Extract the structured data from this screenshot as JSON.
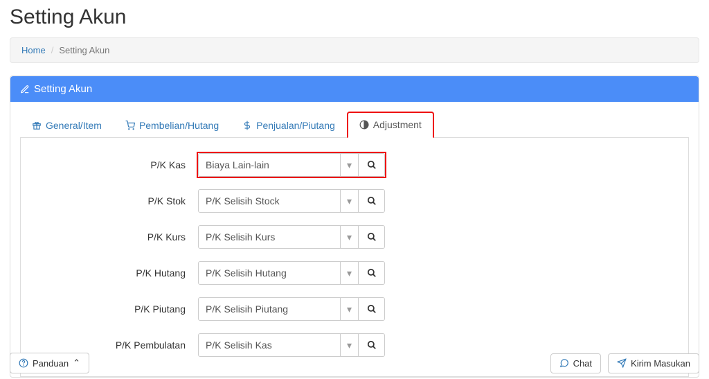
{
  "page": {
    "title": "Setting Akun"
  },
  "breadcrumb": {
    "home": "Home",
    "current": "Setting Akun"
  },
  "panel": {
    "title": "Setting Akun"
  },
  "tabs": [
    {
      "id": "general",
      "label": "General/Item",
      "icon": "gift"
    },
    {
      "id": "pembelian",
      "label": "Pembelian/Hutang",
      "icon": "cart"
    },
    {
      "id": "penjualan",
      "label": "Penjualan/Piutang",
      "icon": "dollar"
    },
    {
      "id": "adjustment",
      "label": "Adjustment",
      "icon": "contrast",
      "active": true,
      "highlight": true
    }
  ],
  "form": {
    "rows": [
      {
        "id": "pk-kas",
        "label": "P/K Kas",
        "value": "Biaya Lain-lain",
        "highlight": true
      },
      {
        "id": "pk-stok",
        "label": "P/K Stok",
        "value": "P/K Selisih Stock"
      },
      {
        "id": "pk-kurs",
        "label": "P/K Kurs",
        "value": "P/K Selisih Kurs"
      },
      {
        "id": "pk-hutang",
        "label": "P/K Hutang",
        "value": "P/K Selisih Hutang"
      },
      {
        "id": "pk-piutang",
        "label": "P/K Piutang",
        "value": "P/K Selisih Piutang"
      },
      {
        "id": "pk-pembulatan",
        "label": "P/K Pembulatan",
        "value": "P/K Selisih Kas"
      }
    ]
  },
  "footer": {
    "panduan": "Panduan",
    "chat": "Chat",
    "kirim": "Kirim Masukan"
  }
}
